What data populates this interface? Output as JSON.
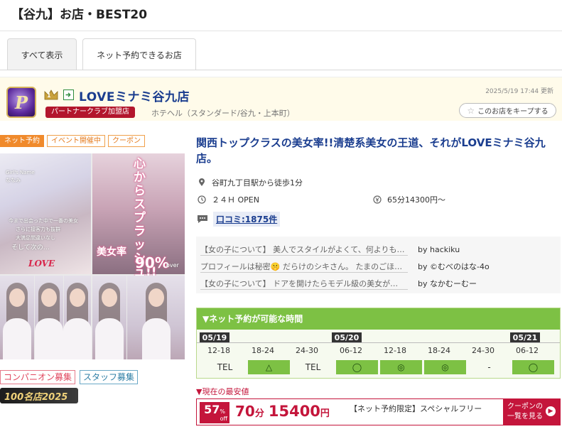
{
  "page": {
    "title": "【谷九】お店・BEST20"
  },
  "tabs": [
    {
      "label": "すべて表示",
      "active": true
    },
    {
      "label": "ネット予約できるお店",
      "active": false
    }
  ],
  "shop": {
    "rank": "1",
    "logo_letter": "P",
    "name": "LOVEミナミ谷九店",
    "partner_badge": "パートナークラブ加盟店",
    "category": "ホテヘル（スタンダード/谷九・上本町）",
    "updated": "2025/5/19 17:44 更新",
    "keep_label": "このお店をキープする",
    "tags": [
      "ネット予約",
      "イベント開催中",
      "クーポン"
    ],
    "catch_copy": "関西トップクラスの美女率!!清楚系美女の王道、それがLOVEミナミ谷九店。",
    "access": "谷町九丁目駅から徒歩1分",
    "hours": "２４Ｈ OPEN",
    "price": "65分14300円〜",
    "reviews_label": "口コミ:1875件",
    "recruit": [
      "コンパニオン募集",
      "スタッフ募集"
    ],
    "award": "100名店2025"
  },
  "photos": {
    "left_name": "Girl's Name",
    "left_name2": "ななみ",
    "left_lines": [
      "今まで出会った中で一番の美女",
      "さらに接客力も抜群",
      "大満足間違いなし",
      "そして次の…"
    ],
    "left_logo": "LOVE",
    "right_heading": "心からスプラッシュ!!",
    "right_stat_label": "美女率",
    "right_stat_value": "90%",
    "right_stat_tail": "over"
  },
  "reviews": [
    {
      "text": "【女の子について】 美人でスタイルがよくて、何よりも…",
      "author": "by hackiku"
    },
    {
      "text": "プロフィールは秘密🤫 だらけのシキさん。 たまのごほうび…",
      "author": "by ©むべのはな-4o"
    },
    {
      "text": "【女の子について】 ドアを開けたらモデル級の美女が…",
      "author": "by なかむーむー"
    }
  ],
  "reservation": {
    "heading": "▼ネット予約が可能な時間",
    "dates": [
      "05/19",
      "05/20",
      "05/21"
    ],
    "slots": [
      "12-18",
      "18-24",
      "24-30",
      "06-12",
      "12-18",
      "18-24",
      "24-30",
      "06-12"
    ],
    "availability": [
      {
        "text": "TEL",
        "on": false
      },
      {
        "text": "△",
        "on": true
      },
      {
        "text": "TEL",
        "on": false
      },
      {
        "text": "◯",
        "on": true
      },
      {
        "text": "◎",
        "on": true
      },
      {
        "text": "◎",
        "on": true
      },
      {
        "text": "-",
        "on": false
      },
      {
        "text": "◯",
        "on": true
      }
    ]
  },
  "coupon": {
    "lowest_label": "▼現在の最安値",
    "discount_pct": "57",
    "pct_symbol": "%",
    "off_label": "off",
    "minutes": "70",
    "minutes_unit": "分",
    "price": "15400",
    "price_unit": "円",
    "description": "【ネット予約限定】スペシャルフリー",
    "button_line1": "クーポンの",
    "button_line2": "一覧を見る",
    "button_arrow": "▶"
  },
  "colors": {
    "shop_name": "#1a3d8f",
    "partner_red": "#b3162c",
    "reserve_green": "#7dc144",
    "coupon_red": "#c4153b",
    "tag_orange": "#f08a2c"
  },
  "icons": {
    "crown": "crown-icon",
    "external": "external-link-icon",
    "keep": "star-icon",
    "access": "map-pin-icon",
    "hours": "clock-icon",
    "price": "yen-icon",
    "reviews": "speech-bubble-icon"
  }
}
